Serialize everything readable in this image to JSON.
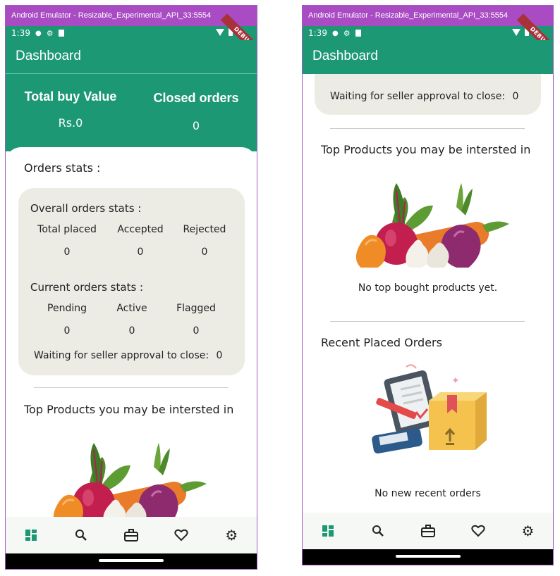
{
  "window": {
    "title": "Android Emulator - Resizable_Experimental_API_33:5554"
  },
  "status": {
    "time": "1:39",
    "debug": "DEBUG"
  },
  "appbar": {
    "title": "Dashboard"
  },
  "header": {
    "total_buy_label": "Total buy Value",
    "total_buy_value": "Rs.0",
    "closed_orders_label": "Closed orders",
    "closed_orders_value": "0"
  },
  "orders": {
    "section_title": "Orders stats :",
    "overall_title": "Overall orders stats :",
    "overall": [
      {
        "label": "Total placed",
        "value": "0"
      },
      {
        "label": "Accepted",
        "value": "0"
      },
      {
        "label": "Rejected",
        "value": "0"
      }
    ],
    "current_title": "Current orders stats :",
    "current": [
      {
        "label": "Pending",
        "value": "0"
      },
      {
        "label": "Active",
        "value": "0"
      },
      {
        "label": "Flagged",
        "value": "0"
      }
    ],
    "waiting_label": "Waiting for seller approval to close:",
    "waiting_value": "0"
  },
  "top_products": {
    "title": "Top Products you may be intersted in",
    "empty": "No top bought products yet."
  },
  "recent_orders": {
    "title": "Recent Placed Orders",
    "empty": "No new recent orders"
  },
  "nav_icons": [
    "dashboard-icon",
    "search-icon",
    "briefcase-icon",
    "heart-icon",
    "settings-icon"
  ],
  "colors": {
    "primary": "#1c9874",
    "titlebar": "#a94bc3",
    "stats_card": "#ecebe4",
    "debug_banner": "#a8323a"
  }
}
